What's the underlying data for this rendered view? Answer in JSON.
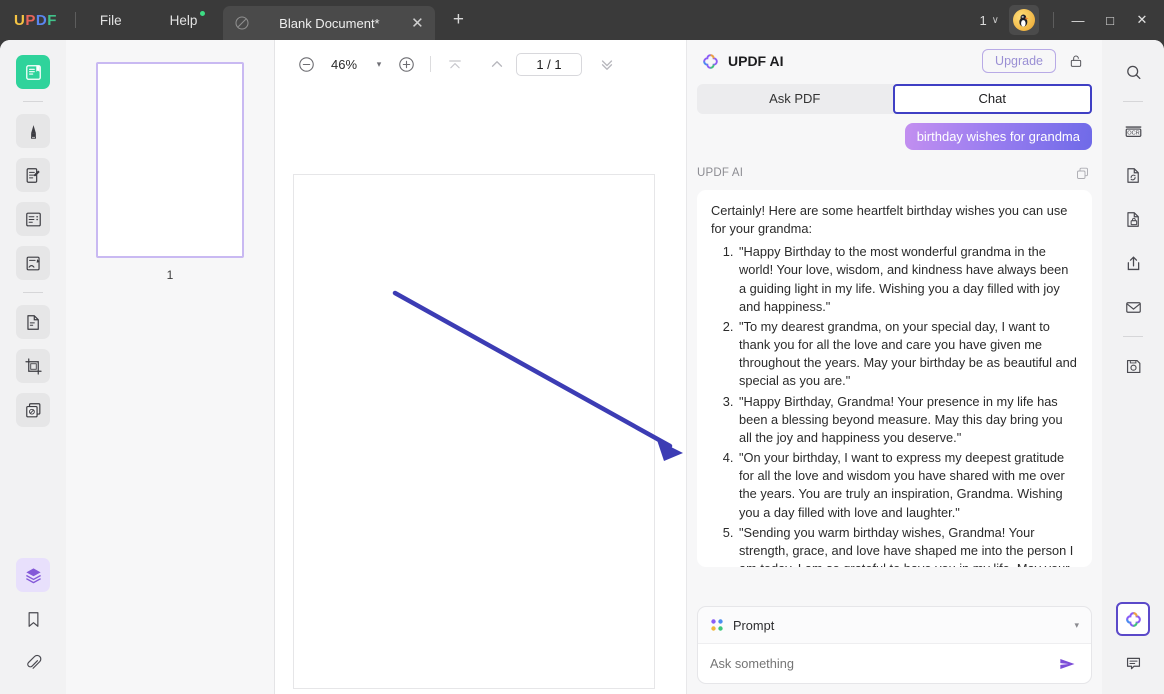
{
  "titlebar": {
    "logo_letters": [
      "U",
      "P",
      "D",
      "F"
    ],
    "menus": [
      {
        "label": "File",
        "has_dot": false
      },
      {
        "label": "Help",
        "has_dot": true
      }
    ],
    "tab": {
      "title": "Blank Document*",
      "file_icon": "pdf-disabled-icon",
      "close_icon": "✕",
      "new_tab_icon": "+"
    },
    "user_count": "1",
    "user_caret": "∨",
    "avatar_icon": "puffin-avatar",
    "window_controls": {
      "minimize": "—",
      "maximize": "□",
      "close": "✕"
    }
  },
  "rail_left": {
    "items": [
      {
        "name": "reader-tool",
        "icon": "book-reader-icon",
        "state": "active-green"
      },
      {
        "name": "comment-tool",
        "icon": "highlighter-icon",
        "state": "normal"
      },
      {
        "name": "edit-pdf-tool",
        "icon": "edit-document-icon",
        "state": "normal"
      },
      {
        "name": "form-tool",
        "icon": "form-fields-icon",
        "state": "normal"
      },
      {
        "name": "sign-tool",
        "icon": "signature-icon",
        "state": "normal"
      },
      {
        "name": "page-tool",
        "icon": "page-edit-icon",
        "state": "normal"
      },
      {
        "name": "crop-tool",
        "icon": "crop-icon",
        "state": "normal"
      },
      {
        "name": "organize-tool",
        "icon": "batch-pages-icon",
        "state": "normal"
      }
    ],
    "bottom_items": [
      {
        "name": "layers-panel",
        "icon": "layers-icon",
        "state": "active-purple"
      },
      {
        "name": "bookmarks-panel",
        "icon": "bookmark-icon",
        "state": "normal"
      },
      {
        "name": "attachments-panel",
        "icon": "paperclip-icon",
        "state": "normal"
      }
    ]
  },
  "rail_right": {
    "items": [
      {
        "name": "search-tool",
        "icon": "search-icon"
      },
      {
        "name": "ocr-tool",
        "icon": "ocr-icon",
        "label": "OCR"
      },
      {
        "name": "convert-tool",
        "icon": "convert-icon"
      },
      {
        "name": "protect-tool",
        "icon": "document-lock-icon"
      },
      {
        "name": "share-tool",
        "icon": "share-upload-icon"
      },
      {
        "name": "email-tool",
        "icon": "envelope-icon"
      },
      {
        "name": "save-tool",
        "icon": "floppy-save-icon"
      }
    ],
    "bottom_items": [
      {
        "name": "updf-ai-tool",
        "icon": "updf-ai-clover-icon",
        "state": "selected"
      },
      {
        "name": "comments-tool",
        "icon": "comment-bubble-icon",
        "state": "normal"
      }
    ]
  },
  "thumbnails": {
    "pages": [
      {
        "number": "1",
        "selected": true
      }
    ]
  },
  "doc_toolbar": {
    "zoom_out_icon": "minus-circle-icon",
    "zoom_value": "46%",
    "zoom_caret": "▾",
    "zoom_in_icon": "plus-circle-icon",
    "first_page_icon": "first-page-icon",
    "prev_page_icon": "prev-page-icon",
    "page_indicator": "1 / 1",
    "next_page_icon": "next-page-icon"
  },
  "document": {
    "annotation": {
      "type": "arrow",
      "color": "#3c3cb4"
    }
  },
  "ai_panel": {
    "logo_icon": "updf-ai-clover-icon",
    "title": "UPDF AI",
    "upgrade_label": "Upgrade",
    "lock_icon": "unlock-icon",
    "tabs": [
      {
        "label": "Ask PDF",
        "selected": false
      },
      {
        "label": "Chat",
        "selected": true
      }
    ],
    "conversation": {
      "user_message": "birthday wishes for grandma",
      "assistant_label": "UPDF AI",
      "copy_icon": "copy-icon",
      "assistant_intro": "Certainly! Here are some heartfelt birthday wishes you can use for your grandma:",
      "assistant_items": [
        "\"Happy Birthday to the most wonderful grandma in the world! Your love, wisdom, and kindness have always been a guiding light in my life. Wishing you a day filled with joy and happiness.\"",
        "\"To my dearest grandma, on your special day, I want to thank you for all the love and care you have given me throughout the years. May your birthday be as beautiful and special as you are.\"",
        "\"Happy Birthday, Grandma! Your presence in my life has been a blessing beyond measure. May this day bring you all the joy and happiness you deserve.\"",
        "\"On your birthday, I want to express my deepest gratitude for all the love and wisdom you have shared with me over the years. You are truly an inspiration, Grandma. Wishing you a day filled with love and laughter.\"",
        "\"Sending you warm birthday wishes, Grandma! Your strength, grace, and love have shaped me into the person I am today. I am so grateful to have you in my life. May your birthday be as special as you are to me.\""
      ]
    },
    "composer": {
      "prompt_icon": "four-dots-icon",
      "prompt_label": "Prompt",
      "prompt_caret": "▾",
      "input_value": "",
      "input_placeholder": "Ask something",
      "send_icon": "send-arrow-icon"
    }
  },
  "colors": {
    "titlebar_bg": "#3a3a3a",
    "accent_purple": "#6f6ae8",
    "tab_selected_border": "#3f3fc4",
    "active_green": "#2fd39b",
    "annotation_blue": "#3c3cb4"
  }
}
